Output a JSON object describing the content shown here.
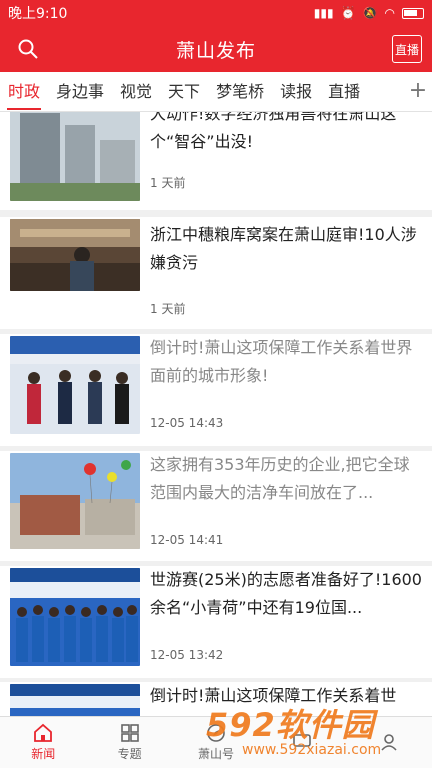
{
  "status": {
    "time": "晚上9:10"
  },
  "header": {
    "title": "萧山发布",
    "live_label": "直播"
  },
  "tabs": [
    "时政",
    "身边事",
    "视觉",
    "天下",
    "梦笔桥",
    "读报",
    "直播"
  ],
  "tabs_plus": "+",
  "articles": [
    {
      "title": "大动作!数字经济独角兽将在萧山这个“智谷”出没!",
      "time": "1 天前",
      "read": false
    },
    {
      "title": "浙江中穗粮库窝案在萧山庭审!10人涉嫌贪污",
      "time": "1 天前",
      "read": false
    },
    {
      "title": "倒计时!萧山这项保障工作关系着世界面前的城市形象!",
      "time": "12-05 14:43",
      "read": true
    },
    {
      "title": "这家拥有353年历史的企业,把它全球范围内最大的洁净车间放在了...",
      "time": "12-05 14:41",
      "read": true
    },
    {
      "title": "世游赛(25米)的志愿者准备好了!1600余名“小青荷”中还有19位国...",
      "time": "12-05 13:42",
      "read": false
    },
    {
      "title": "倒计时!萧山这项保障工作关系着世",
      "time": "",
      "read": false
    }
  ],
  "nav": [
    "新闻",
    "专题",
    "萧山号",
    "",
    ""
  ],
  "watermark": {
    "brand": "592软件园",
    "url": "www.592xiazai.com"
  },
  "colors": {
    "brand_red": "#e8262e",
    "watermark_orange": "#f07b1e"
  }
}
